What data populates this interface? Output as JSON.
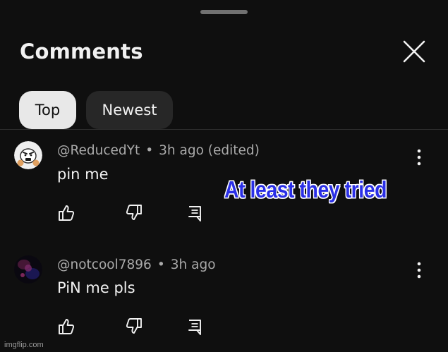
{
  "sheet": {
    "title": "Comments",
    "close_icon": "close-icon"
  },
  "filters": {
    "top_label": "Top",
    "newest_label": "Newest",
    "selected": "Top"
  },
  "comments": [
    {
      "author": "@ReducedYt",
      "separator": "•",
      "time": "3h ago (edited)",
      "text": "pin me",
      "avatar_icon": "avatar-icon",
      "menu_icon": "more-vertical-icon"
    },
    {
      "author": "@notcool7896",
      "separator": "•",
      "time": "3h ago",
      "text": "PiN me pls",
      "avatar_icon": "avatar-icon",
      "menu_icon": "more-vertical-icon"
    }
  ],
  "overlay": {
    "caption": "At least they tried",
    "caption_color": "#2a2fe6"
  },
  "watermark": "imgflip.com"
}
